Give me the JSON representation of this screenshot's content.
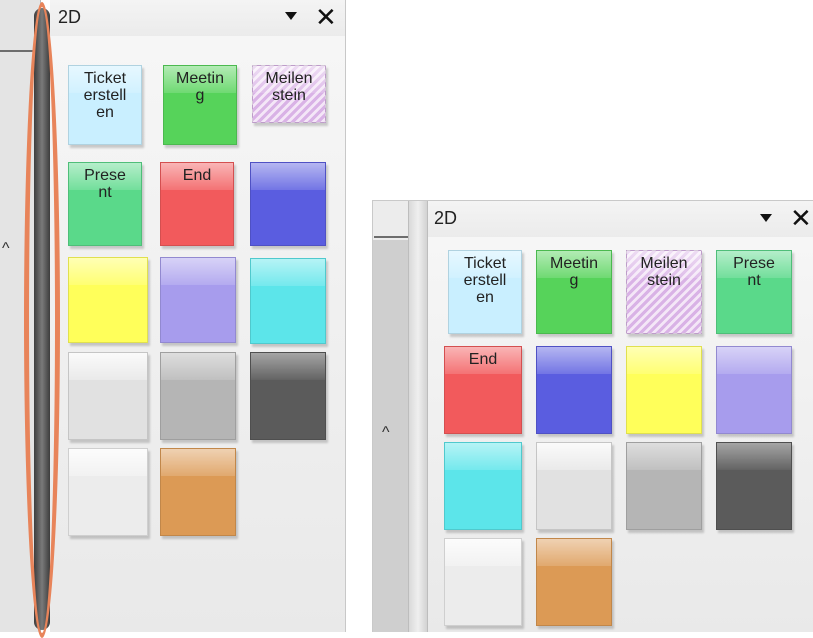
{
  "left_panel": {
    "title": "2D",
    "menu_icon": "dropdown-arrow",
    "close_label": "✕",
    "scroll_up_label": "^",
    "highlight_color": "#e8845a",
    "tiles": [
      {
        "label": "Ticket erstell en",
        "color": "#c9efff"
      },
      {
        "label": "Meetin g",
        "color": "#56d35a"
      },
      {
        "label": "Meilen stein",
        "color": "#d9b2e6"
      },
      {
        "label": "Prese nt",
        "color": "#5ad98a"
      },
      {
        "label": "End",
        "color": "#f25a5c"
      },
      {
        "label": "",
        "color": "#5a5de0"
      },
      {
        "label": "",
        "color": "#ffff5a"
      },
      {
        "label": "",
        "color": "#a79ced"
      },
      {
        "label": "",
        "color": "#5ce5ea"
      },
      {
        "label": "",
        "color": "#e1e1e1"
      },
      {
        "label": "",
        "color": "#b5b5b5"
      },
      {
        "label": "",
        "color": "#5b5b5b"
      },
      {
        "label": "",
        "color": "#ececec"
      },
      {
        "label": "",
        "color": "#dc9a55"
      }
    ]
  },
  "right_panel": {
    "title": "2D",
    "menu_icon": "dropdown-arrow",
    "close_label": "✕",
    "scroll_up_label": "^",
    "tiles": [
      {
        "label": "Ticket erstell en",
        "color": "#c9efff"
      },
      {
        "label": "Meetin g",
        "color": "#56d35a"
      },
      {
        "label": "Meilen stein",
        "color": "#d9b2e6"
      },
      {
        "label": "Prese nt",
        "color": "#5ad98a"
      },
      {
        "label": "End",
        "color": "#f25a5c"
      },
      {
        "label": "",
        "color": "#5a5de0"
      },
      {
        "label": "",
        "color": "#ffff5a"
      },
      {
        "label": "",
        "color": "#a79ced"
      },
      {
        "label": "",
        "color": "#5ce5ea"
      },
      {
        "label": "",
        "color": "#e1e1e1"
      },
      {
        "label": "",
        "color": "#b5b5b5"
      },
      {
        "label": "",
        "color": "#5b5b5b"
      },
      {
        "label": "",
        "color": "#ececec"
      },
      {
        "label": "",
        "color": "#dc9a55"
      }
    ]
  }
}
